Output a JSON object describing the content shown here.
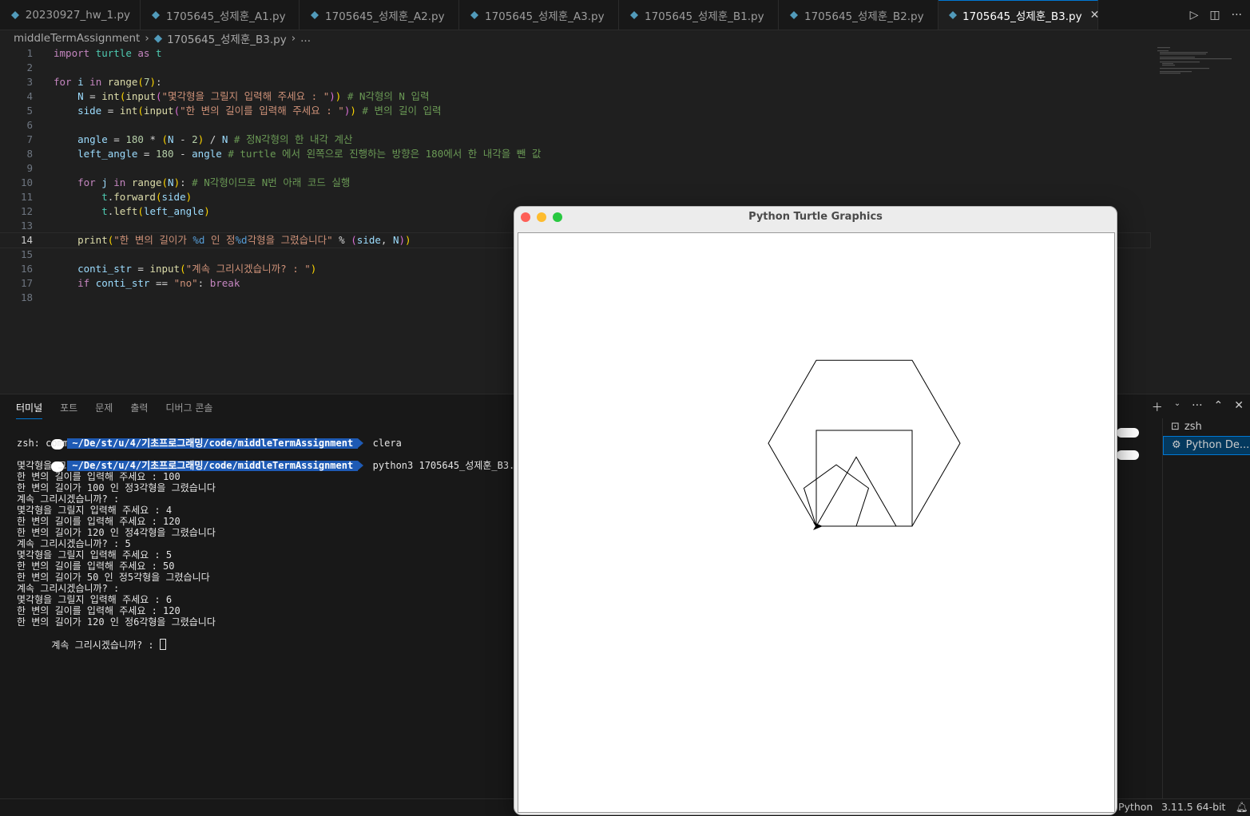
{
  "tabs": [
    {
      "label": "20230927_hw_1.py",
      "active": false
    },
    {
      "label": "1705645_성제훈_A1.py",
      "active": false
    },
    {
      "label": "1705645_성제훈_A2.py",
      "active": false
    },
    {
      "label": "1705645_성제훈_A3.py",
      "active": false
    },
    {
      "label": "1705645_성제훈_B1.py",
      "active": false
    },
    {
      "label": "1705645_성제훈_B2.py",
      "active": false
    },
    {
      "label": "1705645_성제훈_B3.py",
      "active": true
    }
  ],
  "breadcrumb": {
    "folder": "middleTermAssignment",
    "file": "1705645_성제훈_B3.py",
    "more": "..."
  },
  "editor": {
    "current_line": 14,
    "line_numbers": [
      "1",
      "2",
      "3",
      "4",
      "5",
      "6",
      "7",
      "8",
      "9",
      "10",
      "11",
      "12",
      "13",
      "14",
      "15",
      "16",
      "17",
      "18"
    ],
    "lines": [
      "import turtle as t",
      "",
      "for i in range(7):",
      "    N = int(input(\"몇각형을 그릴지 입력해 주세요 : \")) # N각형의 N 입력",
      "    side = int(input(\"한 변의 길이를 입력해 주세요 : \")) # 변의 길이 입력",
      "",
      "    angle = 180 * (N - 2) / N # 정N각형의 한 내각 계산",
      "    left_angle = 180 - angle # turtle 에서 왼쪽으로 진행하는 방향은 180에서 한 내각을 뺀 값",
      "",
      "    for j in range(N): # N각형이므로 N번 아래 코드 실행",
      "        t.forward(side)",
      "        t.left(left_angle)",
      "",
      "    print(\"한 변의 길이가 %d 인 정%d각형을 그렸습니다\" % (side, N))",
      "",
      "    conti_str = input(\"계속 그리시겠습니까? : \")",
      "    if conti_str == \"no\": break",
      ""
    ]
  },
  "panel": {
    "tabs": [
      "터미널",
      "포트",
      "문제",
      "출력",
      "디버그 콘솔"
    ],
    "active_tab": "터미널",
    "prompt_path": "~/De/st/u/4/기초프로그래밍/code/middleTermAssignment",
    "cmd1": "clera",
    "cmd1_output": "zsh: command not found: clera",
    "cmd2": "python3 1705645_성제훈_B3.",
    "output_lines": [
      "몇각형을 그릴지 입력해 주세요 : 3",
      "한 변의 길이를 입력해 주세요 : 100",
      "한 변의 길이가 100 인 정3각형을 그렸습니다",
      "계속 그리시겠습니까? : ",
      "몇각형을 그릴지 입력해 주세요 : 4",
      "한 변의 길이를 입력해 주세요 : 120",
      "한 변의 길이가 120 인 정4각형을 그렸습니다",
      "계속 그리시겠습니까? : 5",
      "몇각형을 그릴지 입력해 주세요 : 5",
      "한 변의 길이를 입력해 주세요 : 50",
      "한 변의 길이가 50 인 정5각형을 그렸습니다",
      "계속 그리시겠습니까? : ",
      "몇각형을 그릴지 입력해 주세요 : 6",
      "한 변의 길이를 입력해 주세요 : 120",
      "한 변의 길이가 120 인 정6각형을 그렸습니다"
    ],
    "last_prompt": "계속 그리시겠습니까? : ",
    "terminals": [
      {
        "label": "zsh",
        "icon": "terminal-icon"
      },
      {
        "label": "Python De...",
        "icon": "debug-icon"
      }
    ]
  },
  "turtle_window": {
    "title": "Python Turtle Graphics",
    "drawn_polygons": [
      {
        "sides": 3,
        "side_length": 100
      },
      {
        "sides": 4,
        "side_length": 120
      },
      {
        "sides": 5,
        "side_length": 50
      },
      {
        "sides": 6,
        "side_length": 120
      }
    ]
  },
  "statusbar": {
    "language": "Python",
    "interpreter": "3.11.5 64-bit"
  }
}
